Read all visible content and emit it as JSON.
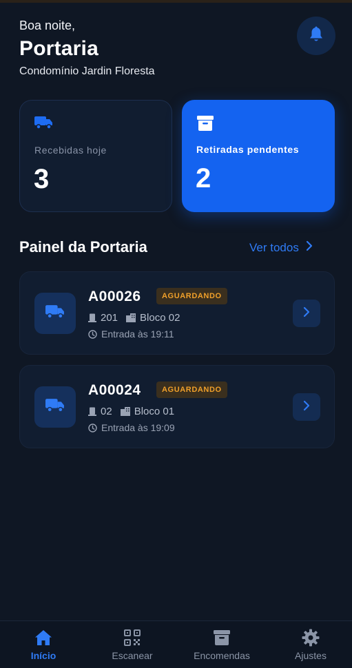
{
  "header": {
    "greeting": "Boa noite,",
    "title": "Portaria",
    "subtitle": "Condomínio Jardin Floresta"
  },
  "stats": [
    {
      "label": "Recebidas hoje",
      "value": "3",
      "icon": "truck-icon"
    },
    {
      "label": "Retiradas pendentes",
      "value": "2",
      "icon": "archive-box-icon"
    }
  ],
  "section": {
    "title": "Painel da Portaria",
    "see_all": "Ver todos"
  },
  "deliveries": [
    {
      "code": "A00026",
      "status": "AGUARDANDO",
      "unit": "201",
      "block": "Bloco 02",
      "entry": "Entrada às 19:11"
    },
    {
      "code": "A00024",
      "status": "AGUARDANDO",
      "unit": "02",
      "block": "Bloco 01",
      "entry": "Entrada às 19:09"
    }
  ],
  "tabs": [
    {
      "label": "Início",
      "icon": "home-icon",
      "active": true
    },
    {
      "label": "Escanear",
      "icon": "qr-code-icon",
      "active": false
    },
    {
      "label": "Encomendas",
      "icon": "archive-box-icon",
      "active": false
    },
    {
      "label": "Ajustes",
      "icon": "gear-icon",
      "active": false
    }
  ],
  "colors": {
    "background": "#0f1724",
    "accent": "#1463f0",
    "badge": "#f0a02a"
  }
}
